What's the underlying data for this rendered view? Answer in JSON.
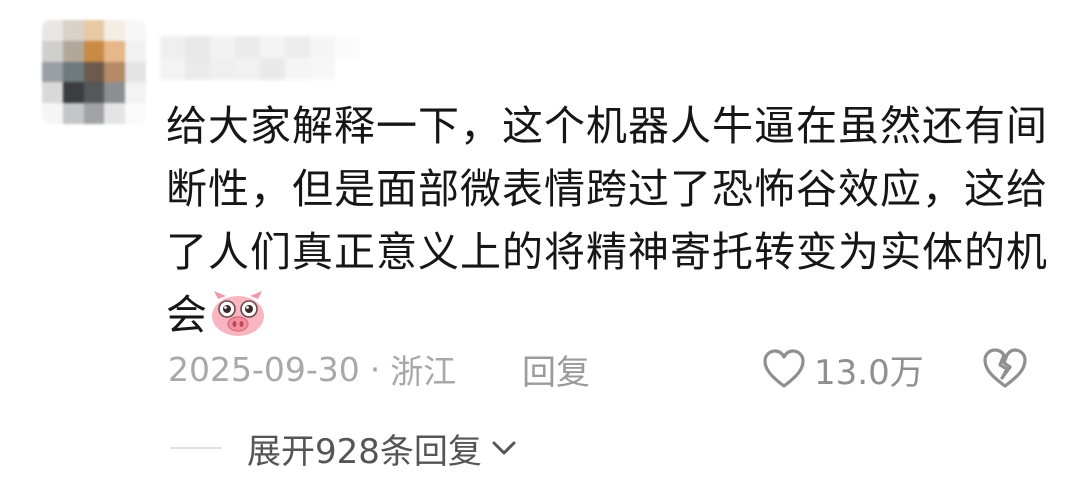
{
  "comment": {
    "content_lines": [
      "给大家解释一下，这个机器人牛逼在虽然还有间",
      "断性，但是面部微表情跨过了恐怖谷效应，这给",
      "了人们真正意义上的将精神寄托转变为实体的机",
      "会"
    ],
    "emoji": "pig-face",
    "date": "2025-09-30",
    "separator": "·",
    "location": "浙江",
    "reply_label": "回复",
    "like_count": "13.0万",
    "expand_label": "展开928条回复"
  },
  "colors": {
    "text": "#161616",
    "meta": "#a8a8a8",
    "icon": "#8f8f8f",
    "emoji_pink": "#f5b3bd"
  }
}
